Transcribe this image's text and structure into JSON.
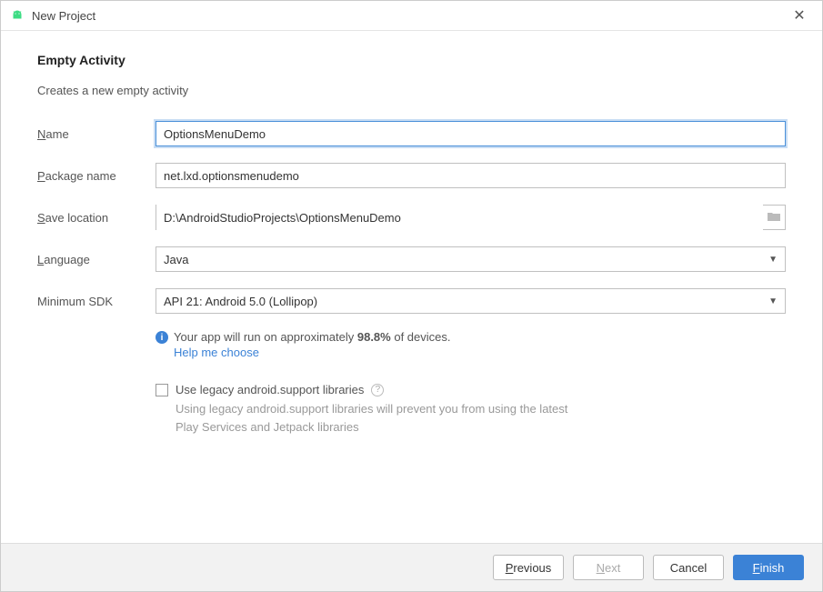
{
  "titlebar": {
    "title": "New Project"
  },
  "page": {
    "heading": "Empty Activity",
    "subtitle": "Creates a new empty activity"
  },
  "form": {
    "name_label_prefix": "N",
    "name_label_rest": "ame",
    "name_value": "OptionsMenuDemo",
    "package_label_prefix": "P",
    "package_label_rest": "ackage name",
    "package_value": "net.lxd.optionsmenudemo",
    "save_label_prefix": "S",
    "save_label_rest": "ave location",
    "save_value": "D:\\AndroidStudioProjects\\OptionsMenuDemo",
    "language_label_prefix": "L",
    "language_label_rest": "anguage",
    "language_value": "Java",
    "minsdk_label": "Minimum SDK",
    "minsdk_value": "API 21: Android 5.0 (Lollipop)"
  },
  "info": {
    "text_before": "Your app will run on approximately ",
    "percent": "98.8%",
    "text_after": " of devices.",
    "help_link": "Help me choose"
  },
  "legacy": {
    "label": "Use legacy android.support libraries",
    "desc": "Using legacy android.support libraries will prevent you from using the latest Play Services and Jetpack libraries"
  },
  "buttons": {
    "previous_prefix": "P",
    "previous_rest": "revious",
    "next_prefix": "N",
    "next_rest": "ext",
    "cancel": "Cancel",
    "finish_prefix": "F",
    "finish_rest": "inish"
  }
}
